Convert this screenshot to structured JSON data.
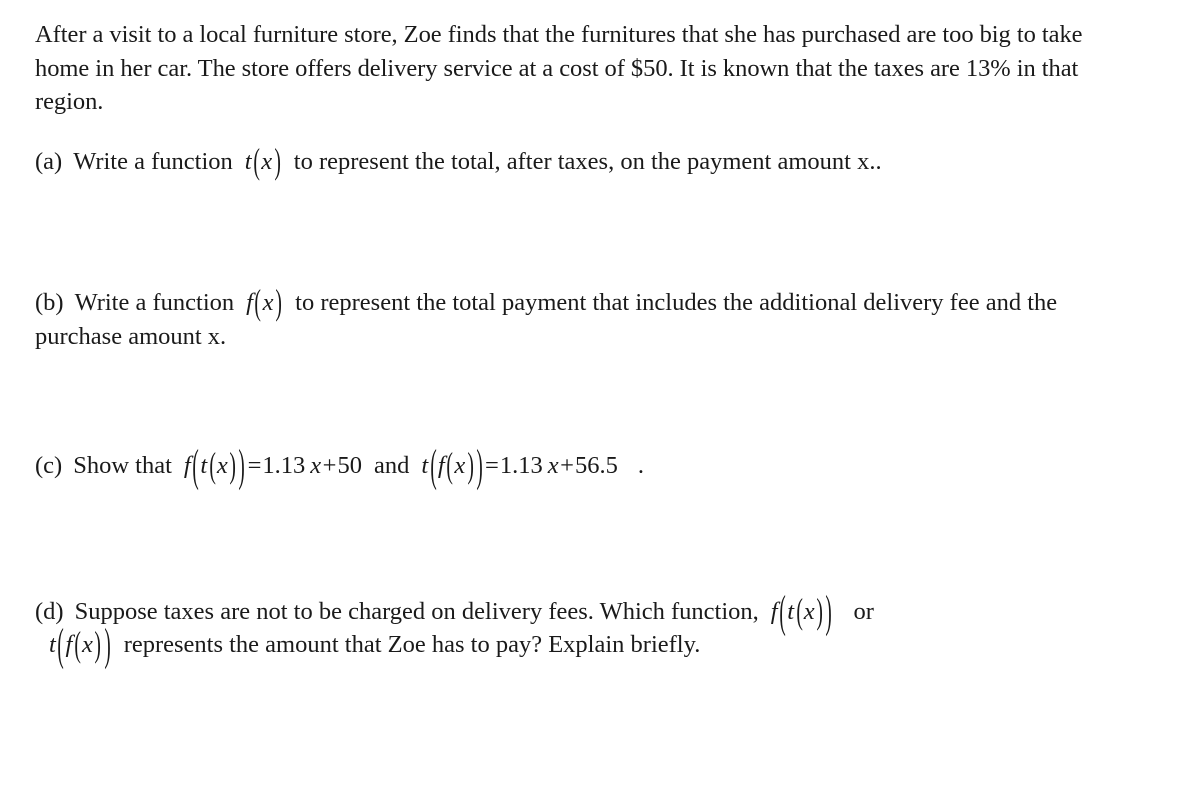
{
  "document": {
    "background_color": "#ffffff",
    "text_color": "#1a1a1a",
    "intro": "After a visit to a local furniture store, Zoe finds that the furnitures that she has purchased are too big to take home in her car. The store offers delivery service at a cost of $50. It is known that the taxes are 13% in that region.",
    "delivery_fee": "$50",
    "tax_rate": "13%",
    "questions": [
      {
        "label": "(a)",
        "text_before": "Write a function",
        "math": "t(x)",
        "text_after": "to represent the total, after taxes, on the payment amount x..",
        "math_parts": {
          "fn": "t",
          "open": "(",
          "var": "x",
          "close": ")"
        }
      },
      {
        "label": "(b)",
        "text_before": "Write a function",
        "math": "f(x)",
        "text_after": "to represent the total payment that includes the additional delivery fee and the purchase amount x.",
        "text_after_line1": "to represent the total payment that includes the additional delivery",
        "text_after_line2": "fee and the purchase amount x.",
        "math_parts": {
          "fn": "f",
          "open": "(",
          "var": "x",
          "close": ")"
        }
      },
      {
        "label": "(c)",
        "text_before": "Show that",
        "equation_1": "f(t(x))=1.13x+50",
        "conjunction": "and",
        "equation_2": "t(f(x))=1.13x+56.5",
        "trailing": ".",
        "equation_1_parts": {
          "outer_fn": "f",
          "inner_fn": "t",
          "var": "x",
          "equals": "=",
          "coefficient": "1.13",
          "plus": "+",
          "constant": "50"
        },
        "equation_2_parts": {
          "outer_fn": "t",
          "inner_fn": "f",
          "var": "x",
          "equals": "=",
          "coefficient": "1.13",
          "plus": "+",
          "constant": "56.5"
        }
      },
      {
        "label": "(d)",
        "text_before": "Suppose taxes are not to be charged on delivery fees. Which function,",
        "math_1": "f(t(x))",
        "conjunction": "or",
        "math_2": "t(f(x))",
        "text_after": "represents the amount that Zoe has to pay? Explain briefly.",
        "math_1_parts": {
          "outer_fn": "f",
          "inner_fn": "t",
          "var": "x"
        },
        "math_2_parts": {
          "outer_fn": "t",
          "inner_fn": "f",
          "var": "x"
        }
      }
    ]
  }
}
